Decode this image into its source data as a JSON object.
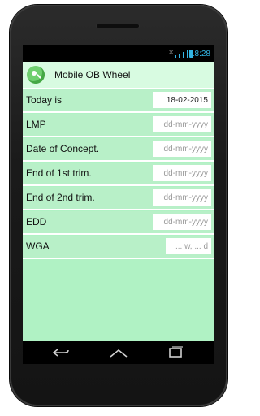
{
  "status_bar": {
    "time": "18:28",
    "icons": [
      "no-sim-icon",
      "signal-icon",
      "battery-icon"
    ]
  },
  "app": {
    "title": "Mobile OB Wheel",
    "background_color": "#b0f2c4",
    "header_color": "#d8fbe1"
  },
  "rows": [
    {
      "label": "Today is",
      "value": "18-02-2015",
      "placeholder": "dd-mm-yyyy"
    },
    {
      "label": "LMP",
      "value": "",
      "placeholder": "dd-mm-yyyy"
    },
    {
      "label": "Date of Concept.",
      "value": "",
      "placeholder": "dd-mm-yyyy"
    },
    {
      "label": "End of 1st trim.",
      "value": "",
      "placeholder": "dd-mm-yyyy"
    },
    {
      "label": "End of 2nd trim.",
      "value": "",
      "placeholder": "dd-mm-yyyy"
    },
    {
      "label": "EDD",
      "value": "",
      "placeholder": "dd-mm-yyyy"
    },
    {
      "label": "WGA",
      "value": "",
      "placeholder": "... w, ... d"
    }
  ],
  "navigation": {
    "buttons": [
      "back-icon",
      "home-icon",
      "recent-apps-icon"
    ]
  }
}
